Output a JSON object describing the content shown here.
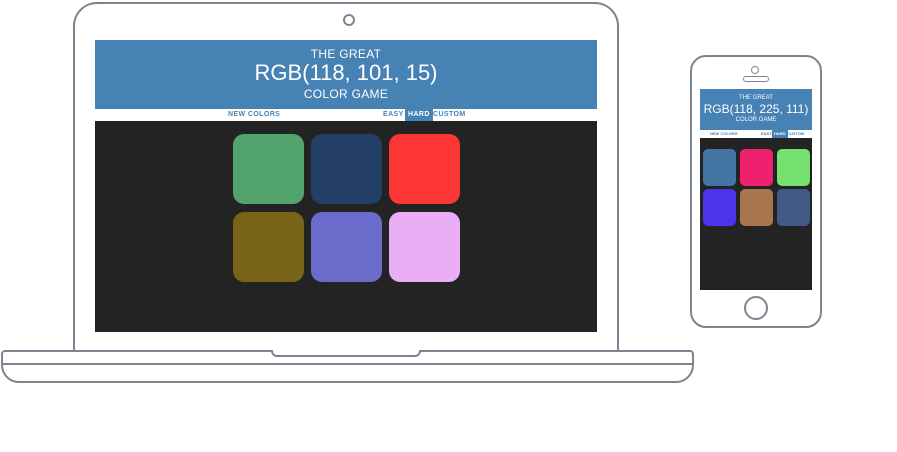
{
  "laptop": {
    "header": {
      "line1": "THE GREAT",
      "rgb": "RGB(118, 101, 15)",
      "line3": "COLOR GAME"
    },
    "menu": {
      "new_colors": "NEW COLORS",
      "easy": "EASY",
      "hard": "HARD",
      "custom": "CUSTOM",
      "selected": "hard"
    },
    "squares": [
      "#52a36e",
      "#243f66",
      "#fb3634",
      "#786319",
      "#6a6bcb",
      "#e9aef6"
    ],
    "colors": {
      "header_bg": "#4682b4",
      "board_bg": "#232323"
    }
  },
  "phone": {
    "header": {
      "line1": "THE GREAT",
      "rgb": "RGB(118, 225, 111)",
      "line3": "COLOR GAME"
    },
    "menu": {
      "new_colors": "NEW COLORS",
      "easy": "EASY",
      "hard": "HARD",
      "custom": "CUSTOM",
      "selected": "hard"
    },
    "squares": [
      "#4375a3",
      "#ef216f",
      "#76e16f",
      "#4d34ea",
      "#a8754f",
      "#425b86"
    ]
  }
}
